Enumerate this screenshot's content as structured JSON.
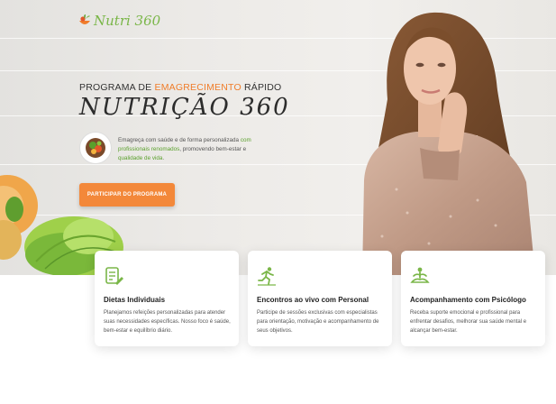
{
  "brand": {
    "logo_text": "Nutri 360",
    "logo_icon": "fruit-bowl-icon",
    "colors": {
      "green": "#7ab648",
      "orange": "#f07d2a",
      "button": "#f3883a"
    }
  },
  "hero": {
    "eyebrow_part1": "PROGRAMA DE ",
    "eyebrow_highlight": "EMAGRECIMENTO",
    "eyebrow_part2": " RÁPIDO",
    "title": "NUTRIÇÃO 360",
    "desc_part1": "Emagreça com saúde e de forma personalizada ",
    "desc_link1": "com profissionais renomados",
    "desc_part2": ", promovendo bem-estar e ",
    "desc_link2": "qualidade de vida",
    "desc_part3": ".",
    "cta_label": "PARTICIPAR DO PROGRAMA"
  },
  "features": [
    {
      "icon": "document-edit-icon",
      "title": "Dietas Individuais",
      "text": "Planejamos refeições personalizadas para atender suas necessidades específicas. Nosso foco é saúde, bem-estar e equilíbrio diário."
    },
    {
      "icon": "runner-icon",
      "title": "Encontros ao vivo com Personal",
      "text": "Participe de sessões exclusivas com especialistas para orientação, motivação e acompanhamento de seus objetivos."
    },
    {
      "icon": "meditation-icon",
      "title": "Acompanhamento com Psicólogo",
      "text": "Receba suporte emocional e profissional para enfrentar desafios, melhorar sua saúde mental e alcançar bem-estar."
    }
  ]
}
